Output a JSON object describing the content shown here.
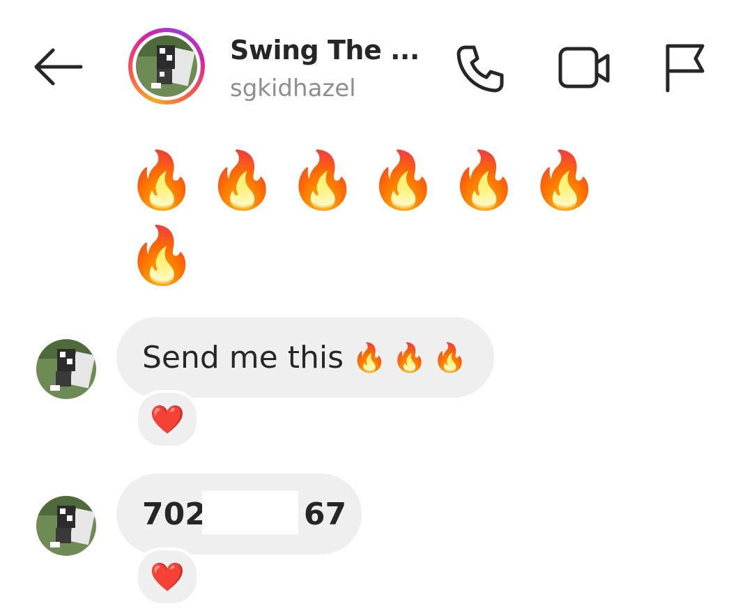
{
  "header": {
    "title": "Swing The ...",
    "subtitle": "sgkidhazel",
    "icons": [
      "back-arrow-icon",
      "phone-icon",
      "video-camera-icon",
      "flag-icon"
    ]
  },
  "messages": [
    {
      "type": "emoji",
      "text": "🔥🔥🔥🔥🔥🔥🔥"
    },
    {
      "type": "text",
      "text": "Send me this",
      "emoji": "🔥🔥🔥",
      "reaction": "❤️"
    },
    {
      "type": "text",
      "text_start": "702",
      "text_end": "67",
      "reaction": "❤️"
    }
  ],
  "colors": {
    "bubble": "#efefef",
    "subtitle": "#8e8e8e",
    "text": "#262626",
    "heart": "#e0245e"
  }
}
